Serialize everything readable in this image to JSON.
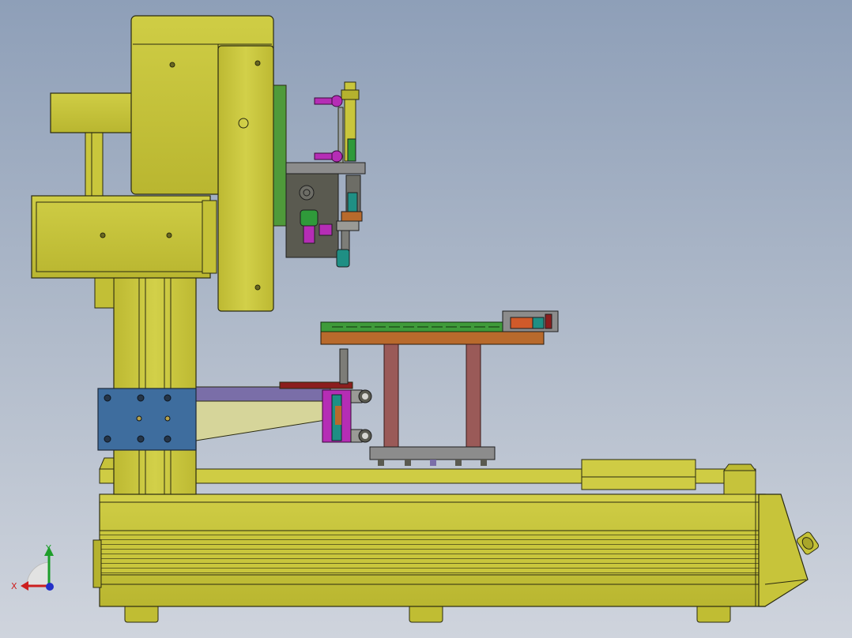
{
  "colors": {
    "body": "#c6c43a",
    "body_dark": "#9e9a1e",
    "outline": "#2a2a10",
    "plate_blue": "#3e6d9e",
    "steel_grey": "#8c8c8c",
    "dark_grey": "#5a5a50",
    "pcb_green": "#3f9b3a",
    "copper": "#b86a2c",
    "pillar_red": "#9a5a58",
    "violet": "#7a6ea8",
    "magenta": "#b52db5",
    "teal": "#1f8f84",
    "dark_red": "#8b1e1e",
    "cylinder_orange": "#d05a2a"
  },
  "triad": {
    "x_label": "X",
    "y_label": "Y",
    "x_color": "#cc1f1f",
    "y_color": "#1e9e2a",
    "z_color": "#2430c8"
  },
  "icons": [
    "coordinate-triad-icon",
    "fitting-icon",
    "screw-head-icon"
  ]
}
